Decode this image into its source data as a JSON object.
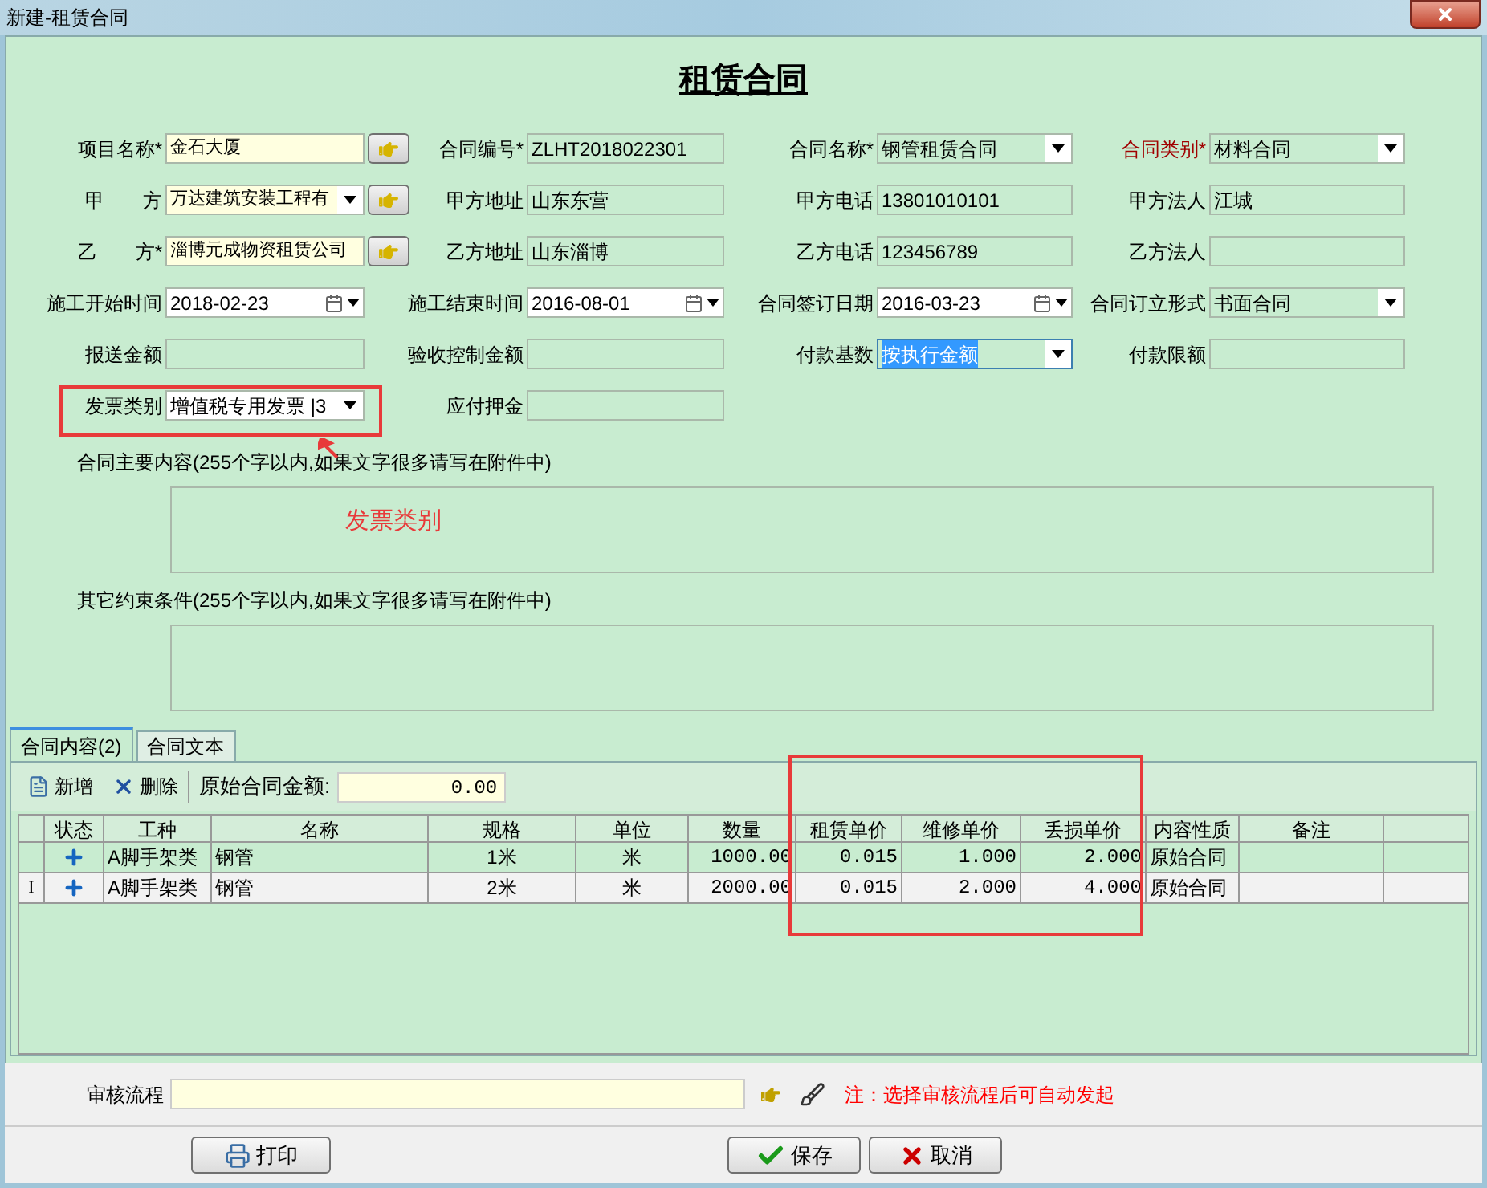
{
  "window": {
    "title": "新建-租赁合同"
  },
  "form_title": "租赁合同",
  "field_rows": [
    [
      {
        "label": "项目名称*",
        "value": "金石大厦",
        "kind": "lookup",
        "emphasis": false
      },
      {
        "label": "合同编号*",
        "value": "ZLHT2018022301",
        "kind": "text",
        "emphasis": false
      },
      {
        "label": "合同名称*",
        "value": "钢管租赁合同",
        "kind": "combo",
        "emphasis": false
      },
      {
        "label": "合同类别*",
        "value": "材料合同",
        "kind": "combo",
        "emphasis": true
      }
    ],
    [
      {
        "label": "甲　　方",
        "value": "万达建筑安装工程有",
        "kind": "combolookup",
        "emphasis": false
      },
      {
        "label": "甲方地址",
        "value": "山东东营",
        "kind": "text",
        "emphasis": false
      },
      {
        "label": "甲方电话",
        "value": "13801010101",
        "kind": "text",
        "emphasis": false
      },
      {
        "label": "甲方法人",
        "value": "江城",
        "kind": "text",
        "emphasis": false
      }
    ],
    [
      {
        "label": "乙　　方*",
        "value": "淄博元成物资租赁公司",
        "kind": "lookup",
        "emphasis": false
      },
      {
        "label": "乙方地址",
        "value": "山东淄博",
        "kind": "text",
        "emphasis": false
      },
      {
        "label": "乙方电话",
        "value": "123456789",
        "kind": "text",
        "emphasis": false
      },
      {
        "label": "乙方法人",
        "kind": "text",
        "emphasis": false
      }
    ],
    [
      {
        "label": "施工开始时间",
        "value": "2018-02-23",
        "kind": "date",
        "emphasis": false
      },
      {
        "label": "施工结束时间",
        "value": "2016-08-01",
        "kind": "date",
        "emphasis": false
      },
      {
        "label": "合同签订日期",
        "value": "2016-03-23",
        "kind": "date",
        "emphasis": false
      },
      {
        "label": "合同订立形式",
        "value": "书面合同",
        "kind": "combo",
        "emphasis": false
      }
    ],
    [
      {
        "label": "报送金额",
        "kind": "text",
        "emphasis": false
      },
      {
        "label": "验收控制金额",
        "kind": "text",
        "emphasis": false
      },
      {
        "label": "付款基数",
        "value": "按执行金额",
        "kind": "combo",
        "emphasis": false,
        "highlighted": true
      },
      {
        "label": "付款限额",
        "kind": "text",
        "emphasis": false
      }
    ],
    [
      {
        "label": "发票类别",
        "value": "增值税专用发票 |3",
        "kind": "whitecombo",
        "emphasis": false
      },
      {
        "label": "应付押金",
        "kind": "text",
        "emphasis": false
      }
    ]
  ],
  "memos": [
    {
      "label": "合同主要内容(255个字以内,如果文字很多请写在附件中)"
    },
    {
      "label": "其它约束条件(255个字以内,如果文字很多请写在附件中)"
    }
  ],
  "annotation": {
    "text": "发票类别"
  },
  "tabs": [
    {
      "label": "合同内容(2)",
      "selected": true
    },
    {
      "label": "合同文本",
      "selected": false
    }
  ],
  "toolbar": {
    "add": "新增",
    "delete": "删除",
    "amount_label": "原始合同金额:",
    "amount_value": "0.00"
  },
  "table": {
    "columns": [
      "状态",
      "工种",
      "名称",
      "规格",
      "单位",
      "数量",
      "租赁单价",
      "维修单价",
      "丢损单价",
      "内容性质",
      "备注"
    ],
    "rows": [
      {
        "selected": true,
        "cells": [
          "",
          "A脚手架类",
          "钢管",
          "1米",
          "米",
          "1000.00",
          "0.015",
          "1.000",
          "2.000",
          "原始合同",
          ""
        ]
      },
      {
        "selected": false,
        "marker": "I",
        "cells": [
          "",
          "A脚手架类",
          "钢管",
          "2米",
          "米",
          "2000.00",
          "0.015",
          "2.000",
          "4.000",
          "原始合同",
          ""
        ]
      }
    ]
  },
  "approval": {
    "label": "审核流程",
    "note": "注：选择审核流程后可自动发起"
  },
  "buttons": {
    "print": "打印",
    "save": "保存",
    "cancel": "取消"
  }
}
